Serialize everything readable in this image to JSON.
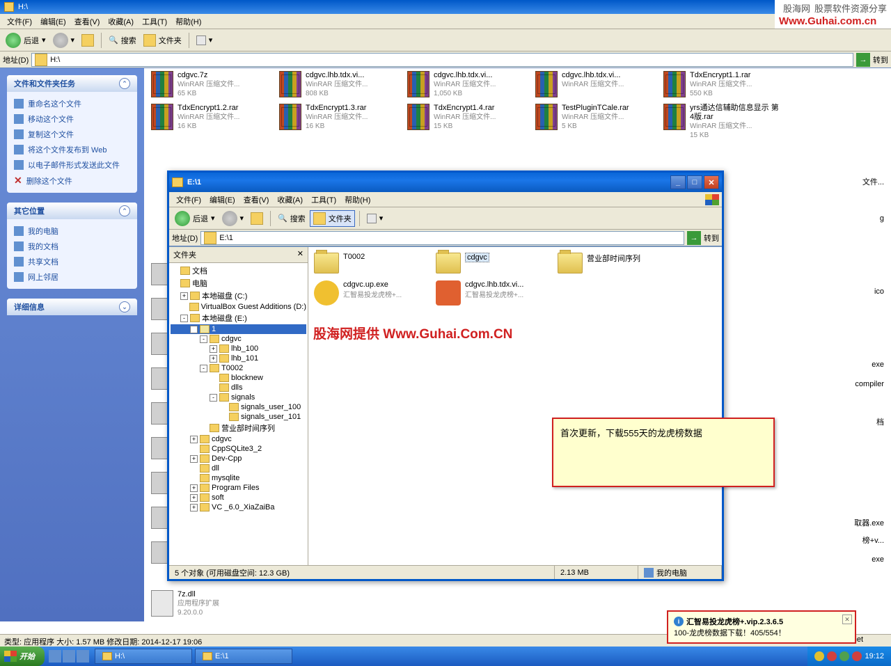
{
  "main_window": {
    "title": "H:\\",
    "menu": [
      "文件(F)",
      "编辑(E)",
      "查看(V)",
      "收藏(A)",
      "工具(T)",
      "帮助(H)"
    ],
    "toolbar": {
      "back": "后退",
      "search": "搜索",
      "folders": "文件夹"
    },
    "address_label": "地址(D)",
    "address_value": "H:\\",
    "go": "转到"
  },
  "left_panel": {
    "tasks_header": "文件和文件夹任务",
    "tasks": [
      "重命名这个文件",
      "移动这个文件",
      "复制这个文件",
      "将这个文件发布到 Web",
      "以电子邮件形式发送此文件",
      "删除这个文件"
    ],
    "other_header": "其它位置",
    "other": [
      "我的电脑",
      "我的文档",
      "共享文档",
      "网上邻居"
    ],
    "detail_header": "详细信息"
  },
  "files_row1": [
    {
      "name": "cdgvc.7z",
      "type": "WinRAR 压缩文件...",
      "size": "65 KB"
    },
    {
      "name": "cdgvc.lhb.tdx.vi...",
      "type": "WinRAR 压缩文件...",
      "size": "808 KB"
    },
    {
      "name": "cdgvc.lhb.tdx.vi...",
      "type": "WinRAR 压缩文件...",
      "size": "1,050 KB"
    },
    {
      "name": "cdgvc.lhb.tdx.vi...",
      "type": "WinRAR 压缩文件...",
      "size": ""
    },
    {
      "name": "TdxEncrypt1.1.rar",
      "type": "WinRAR 压缩文件...",
      "size": "550 KB"
    }
  ],
  "files_row2": [
    {
      "name": "TdxEncrypt1.2.rar",
      "type": "WinRAR 压缩文件...",
      "size": "16 KB"
    },
    {
      "name": "TdxEncrypt1.3.rar",
      "type": "WinRAR 压缩文件...",
      "size": "16 KB"
    },
    {
      "name": "TdxEncrypt1.4.rar",
      "type": "WinRAR 压缩文件...",
      "size": "15 KB"
    },
    {
      "name": "TestPluginTCale.rar",
      "type": "WinRAR 压缩文件...",
      "size": "5 KB"
    },
    {
      "name": "yrs通达信辅助信息显示 第4版.rar",
      "type": "WinRAR 压缩文件...",
      "size": "15 KB"
    }
  ],
  "bottom_file": {
    "name": "7z.dll",
    "type": "应用程序扩展",
    "ver": "9.20.0.0"
  },
  "inner_window": {
    "title": "E:\\1",
    "menu": [
      "文件(F)",
      "编辑(E)",
      "查看(V)",
      "收藏(A)",
      "工具(T)",
      "帮助(H)"
    ],
    "toolbar": {
      "back": "后退",
      "search": "搜索",
      "folders": "文件夹"
    },
    "address_label": "地址(D)",
    "address_value": "E:\\1",
    "go": "转到",
    "tree_header": "文件夹",
    "tree": [
      {
        "lvl": 0,
        "label": "文档",
        "exp": ""
      },
      {
        "lvl": 0,
        "label": "电脑",
        "exp": ""
      },
      {
        "lvl": 1,
        "label": "本地磁盘 (C:)",
        "exp": "+"
      },
      {
        "lvl": 1,
        "label": "VirtualBox Guest Additions (D:)",
        "exp": ""
      },
      {
        "lvl": 1,
        "label": "本地磁盘 (E:)",
        "exp": "-"
      },
      {
        "lvl": 2,
        "label": "1",
        "exp": "-",
        "sel": true,
        "open": true
      },
      {
        "lvl": 3,
        "label": "cdgvc",
        "exp": "-"
      },
      {
        "lvl": 4,
        "label": "lhb_100",
        "exp": "+"
      },
      {
        "lvl": 4,
        "label": "lhb_101",
        "exp": "+"
      },
      {
        "lvl": 3,
        "label": "T0002",
        "exp": "-"
      },
      {
        "lvl": 4,
        "label": "blocknew",
        "exp": ""
      },
      {
        "lvl": 4,
        "label": "dlls",
        "exp": ""
      },
      {
        "lvl": 4,
        "label": "signals",
        "exp": "-"
      },
      {
        "lvl": 5,
        "label": "signals_user_100",
        "exp": ""
      },
      {
        "lvl": 5,
        "label": "signals_user_101",
        "exp": ""
      },
      {
        "lvl": 3,
        "label": "营业部时间序列",
        "exp": ""
      },
      {
        "lvl": 2,
        "label": "cdgvc",
        "exp": "+"
      },
      {
        "lvl": 2,
        "label": "CppSQLite3_2",
        "exp": ""
      },
      {
        "lvl": 2,
        "label": "Dev-Cpp",
        "exp": "+"
      },
      {
        "lvl": 2,
        "label": "dll",
        "exp": ""
      },
      {
        "lvl": 2,
        "label": "mysqlite",
        "exp": ""
      },
      {
        "lvl": 2,
        "label": "Program Files",
        "exp": "+"
      },
      {
        "lvl": 2,
        "label": "soft",
        "exp": "+"
      },
      {
        "lvl": 2,
        "label": "VC _6.0_XiaZaiBa",
        "exp": "+"
      }
    ],
    "folders": [
      {
        "name": "T0002"
      },
      {
        "name": "cdgvc",
        "sel": true
      },
      {
        "name": "营业部时间序列"
      }
    ],
    "exes": [
      {
        "name": "cdgvc.up.exe",
        "desc": "汇智易投龙虎榜+..."
      },
      {
        "name": "cdgvc.lhb.tdx.vi...",
        "desc": "汇智易投龙虎榜+..."
      }
    ],
    "status_left": "5 个对象 (可用磁盘空间: 12.3 GB)",
    "status_size": "2.13 MB",
    "status_loc": "我的电脑"
  },
  "partial_texts": [
    "文件...",
    "g",
    "ico",
    "exe",
    "compiler",
    "档",
    "取器.exe",
    "榜+v...",
    "exe",
    "net"
  ],
  "watermark_top": {
    "line1a": "股海网",
    "line1b": "股票软件资源分享",
    "line2": "Www.Guhai.com.cn"
  },
  "watermark_mid": "股海网提供 Www.Guhai.Com.CN",
  "note": "首次更新，下载555天的龙虎榜数据",
  "balloon": {
    "title": "汇智易投龙虎榜+.vip.2.3.6.5",
    "body": "100-龙虎榜数据下载！405/554！"
  },
  "bottom_status": "类型: 应用程序 大小: 1.57 MB 修改日期: 2014-12-17 19:06",
  "taskbar": {
    "start": "开始",
    "tasks": [
      "H:\\",
      "E:\\1"
    ],
    "time": "19:12"
  }
}
